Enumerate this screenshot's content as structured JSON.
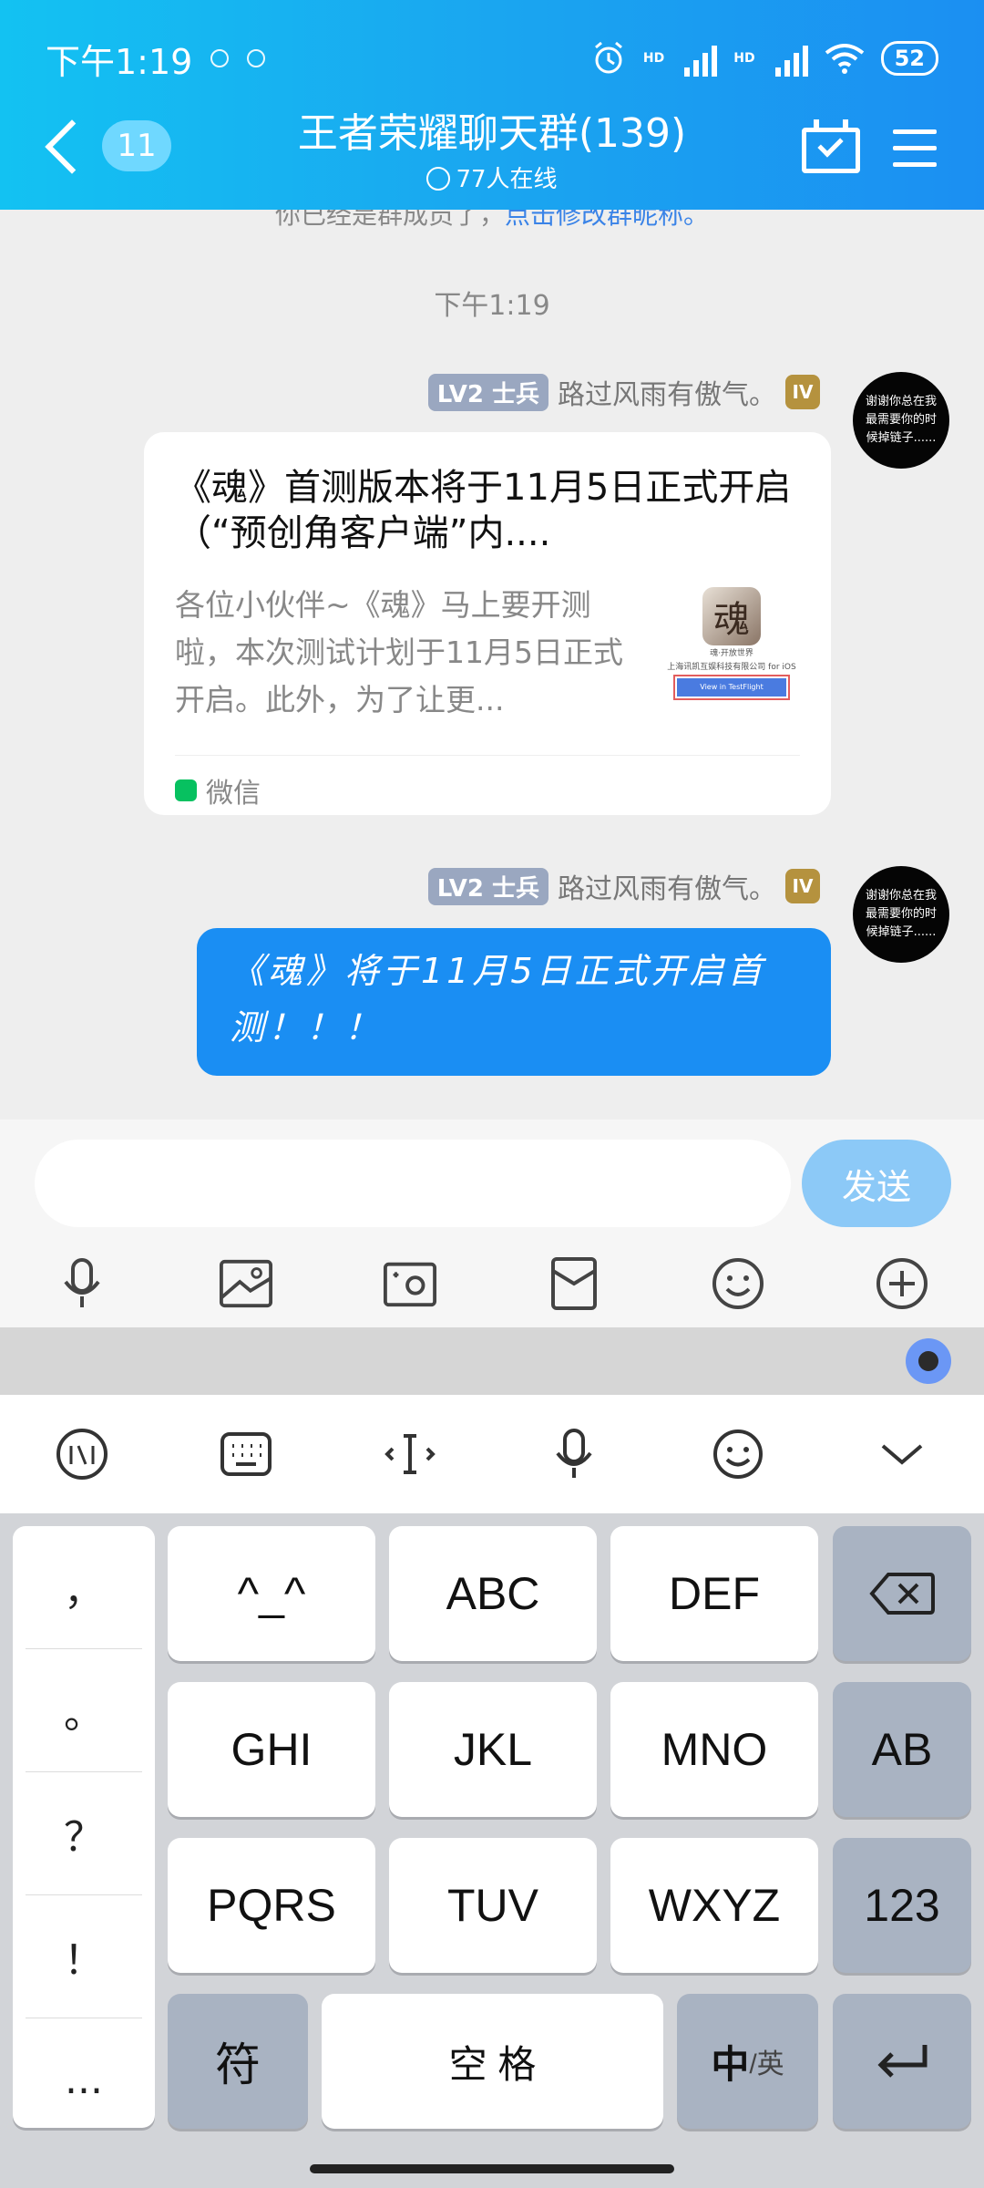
{
  "status_bar": {
    "time": "下午1:19",
    "battery": "52",
    "hd1": "HD",
    "hd2": "HD"
  },
  "header": {
    "back_badge": "11",
    "title": "王者荣耀聊天群(139)",
    "online": "77人在线"
  },
  "chat": {
    "system_notice": "你已经是群成员了，",
    "system_link": "点击修改群昵称。",
    "time_divider": "下午1:19",
    "messages": [
      {
        "level": "LV2 士兵",
        "sender": "路过风雨有傲气。",
        "crown": "IV",
        "avatar_text": "谢谢你总在我最需要你的时候掉链子......",
        "card": {
          "title": "《魂》首测版本将于11月5日正式开启（“预创角客户端”内....",
          "description": "各位小伙伴~《魂》马上要开测啦，本次测试计划于11月5日正式开启。此外，为了让更...",
          "thumb_icon": "魂",
          "thumb_line1": "魂·开放世界",
          "thumb_line2": "上海讯凯互娱科技有限公司 for iOS",
          "thumb_button": "View in TestFlight",
          "source": "微信"
        }
      },
      {
        "level": "LV2 士兵",
        "sender": "路过风雨有傲气。",
        "crown": "IV",
        "avatar_text": "谢谢你总在我最需要你的时候掉链子......",
        "text": "《魂》将于11月5日正式开启首测！！！"
      }
    ]
  },
  "input": {
    "placeholder": "",
    "send_label": "发送"
  },
  "tools": [
    "mic-icon",
    "image-icon",
    "camera-icon",
    "redpacket-icon",
    "emoji-icon",
    "plus-icon"
  ],
  "ime": {
    "toolbar": [
      "xunfei-logo-icon",
      "keyboard-icon",
      "cursor-icon",
      "voice-icon",
      "emoji-icon",
      "collapse-icon"
    ],
    "punct": [
      "，",
      "。",
      "？",
      "！",
      "..."
    ],
    "keys": {
      "r1": [
        "^_^",
        "ABC",
        "DEF"
      ],
      "r2": [
        "GHI",
        "JKL",
        "MNO"
      ],
      "r3": [
        "PQRS",
        "TUV",
        "WXYZ"
      ],
      "ab": "AB",
      "num": "123",
      "fu": "符",
      "space": "空 格",
      "zh": "中",
      "en": "/英"
    }
  },
  "colors": {
    "header_start": "#13c2f2",
    "header_end": "#1b8ff2",
    "bubble": "#1a8ef3",
    "send_disabled": "#8cc9f7"
  }
}
